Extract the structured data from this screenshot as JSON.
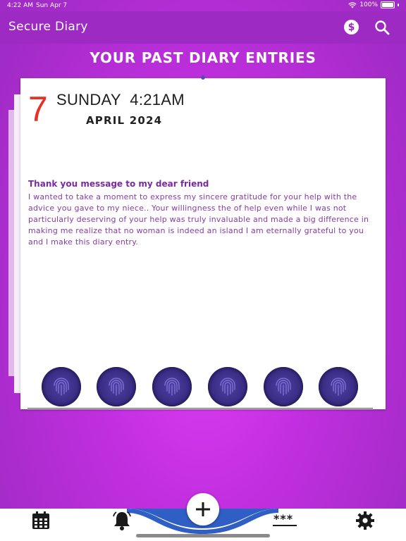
{
  "status_bar": {
    "time": "4:22 AM",
    "date": "Sun Apr 7",
    "battery": "100%"
  },
  "nav": {
    "title": "Secure Diary",
    "dollar_icon": "$"
  },
  "heading": "YOUR PAST DIARY ENTRIES",
  "entry": {
    "day_number": "7",
    "day_time": "SUNDAY  4:21AM",
    "month_year": "APRIL 2024",
    "title": "Thank you message to my dear friend",
    "body": "I wanted to take a moment to express my sincere gratitude for your help with the advice you gave to my niece.. Your willingness the of help even while I was not particularly deserving of your help was truly invaluable and made a big difference in making me realize that no woman is indeed an island I am eternally grateful to you and I make this diary entry."
  },
  "colors": {
    "accent": "#9e2ac4",
    "date_red": "#e53229",
    "tab_wave": "#2f5ec4"
  },
  "tab_bar": {
    "passcode_icon": "***"
  }
}
